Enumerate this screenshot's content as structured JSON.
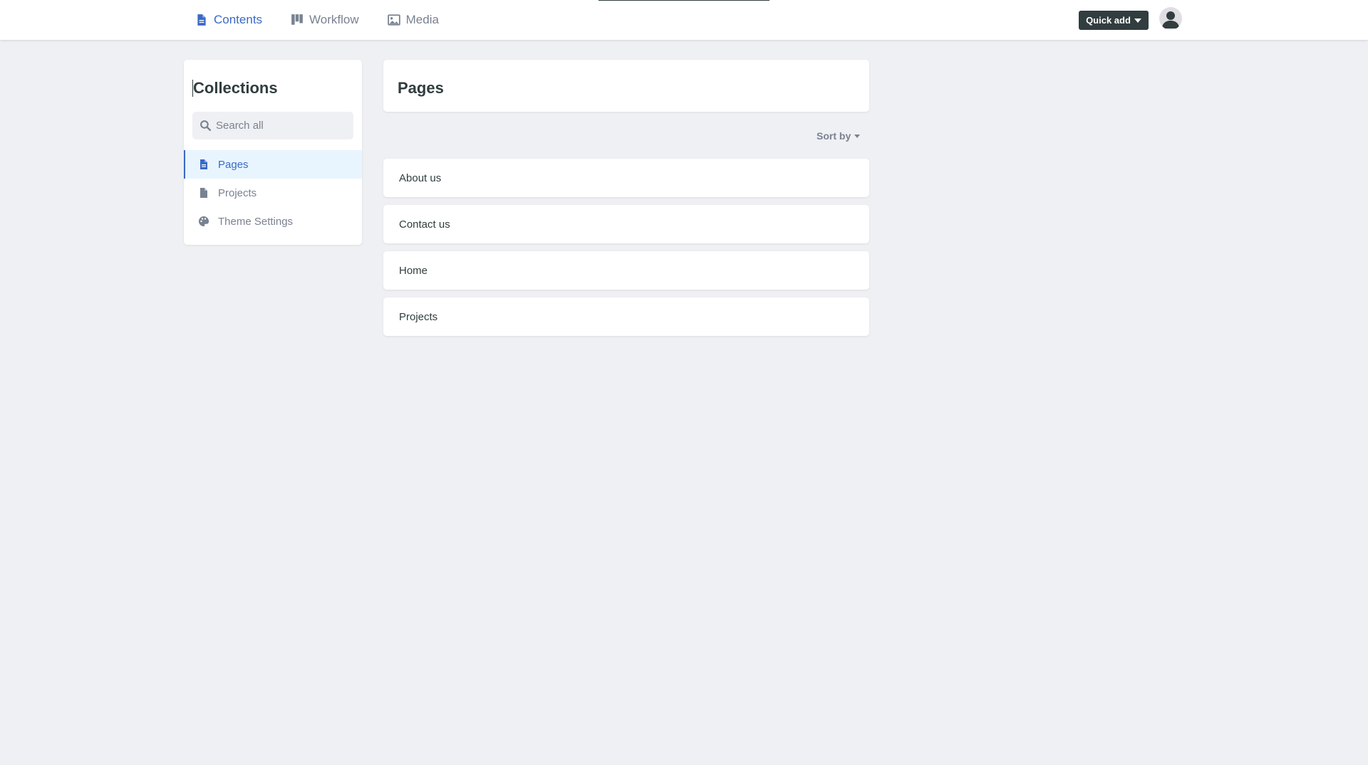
{
  "nav": {
    "items": [
      {
        "label": "Contents",
        "icon": "document-icon",
        "active": true
      },
      {
        "label": "Workflow",
        "icon": "kanban-icon",
        "active": false
      },
      {
        "label": "Media",
        "icon": "image-icon",
        "active": false
      }
    ]
  },
  "header": {
    "quick_add_label": "Quick add"
  },
  "sidebar": {
    "title": "Collections",
    "search_placeholder": "Search all",
    "items": [
      {
        "label": "Pages",
        "icon": "document-icon",
        "active": true
      },
      {
        "label": "Projects",
        "icon": "document-icon",
        "active": false
      },
      {
        "label": "Theme Settings",
        "icon": "palette-icon",
        "active": false
      }
    ]
  },
  "main": {
    "title": "Pages",
    "sort_label": "Sort by",
    "entries": [
      "About us",
      "Contact us",
      "Home",
      "Projects"
    ]
  },
  "colors": {
    "accent": "#3a69c7",
    "background": "#eff0f4",
    "dark": "#313d3e",
    "muted": "#798291",
    "active_bg": "#e8f5fe"
  }
}
